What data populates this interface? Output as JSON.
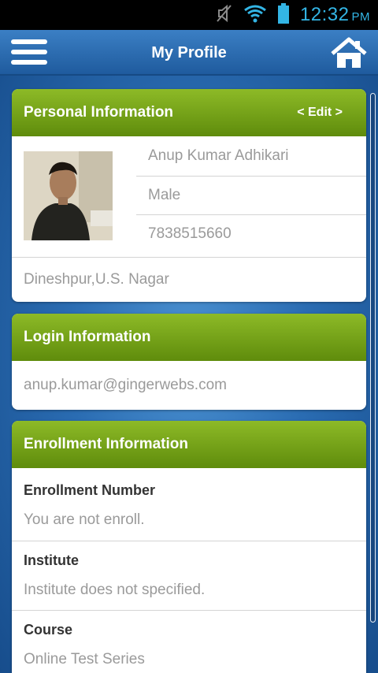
{
  "status_bar": {
    "time": "12:32",
    "ampm": "PM"
  },
  "app_bar": {
    "title": "My Profile"
  },
  "personal": {
    "header": "Personal Information",
    "edit_label": "< Edit >",
    "name": "Anup Kumar Adhikari",
    "gender": "Male",
    "phone": "7838515660",
    "address": "Dineshpur,U.S. Nagar"
  },
  "login": {
    "header": "Login Information",
    "email": "anup.kumar@gingerwebs.com"
  },
  "enrollment": {
    "header": "Enrollment Information",
    "fields": [
      {
        "label": "Enrollment Number",
        "value": "You are not enroll."
      },
      {
        "label": "Institute",
        "value": "Institute does not specified."
      },
      {
        "label": "Course",
        "value": "Online Test Series"
      }
    ]
  },
  "colors": {
    "accent_blue": "#2a6cb2",
    "header_green": "#6f9c14",
    "status_blue": "#33b5e5"
  }
}
